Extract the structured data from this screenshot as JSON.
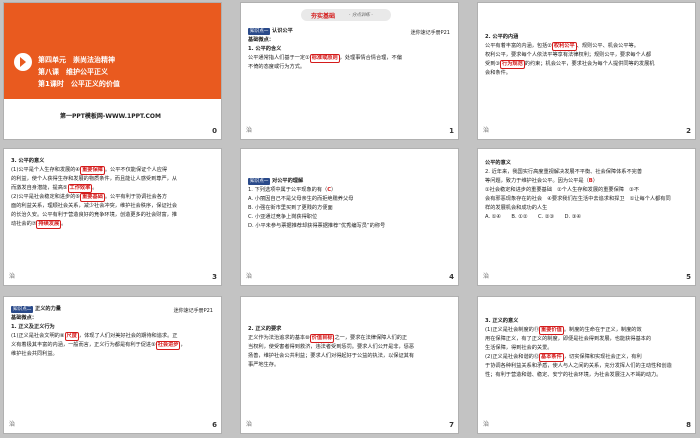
{
  "slides": [
    {
      "page": "0",
      "lines": {
        "unit": "第四单元　崇尚法治精神",
        "lesson": "第八课　维护公平正义",
        "period": "第1课时　公平正义的价值",
        "credit": "第一PPT模板网-WWW.1PPT.COM"
      }
    },
    {
      "page": "1",
      "footer": "治",
      "banner_title": "夯实基础",
      "banner_sub": "· 分点训练 ·",
      "tag": "知识点一",
      "heading": "认识公平",
      "note": "迷你速记手册P21",
      "lines": [
        "基础微点：",
        "1. 公平的含义",
        "公平通常指人们基于一定①",
        "标准或原则",
        "，处理事情合情合理，不偏",
        "不倚的态度或行为方式。"
      ]
    },
    {
      "page": "2",
      "footer": "治",
      "lines": [
        "2. 公平的内涵",
        "公平有着丰富的内涵，包括②",
        "权利公平",
        "、规则公平、机会公平等。",
        "权利公平，要求每个人依法平等享有法律权利；规则公平，要求每个人都",
        "受到③",
        "行为规范",
        "的约束；机会公平，要求社会为每个人提供同等的发展机",
        "会和条件。"
      ]
    },
    {
      "page": "3",
      "footer": "治",
      "lines": [
        "3. 公平的意义",
        "(1)公平是个人生存和发展的④",
        "重要保障",
        "。公平不仅能保证个人应得",
        "的利益，使个人获得生存和发展的物质条件，而且能让人感受到尊严，从",
        "而激发自身潜能，提高⑤",
        "工作效率",
        "。",
        "(2)公平是社会稳定和进步的⑥",
        "重要基础",
        "。公平有利于协调社会各方",
        "面的利益关系，理顺社会关系，减少社会冲突，维护社会秩序，保证社会",
        "的长治久安。公平有利于营造良好的竞争环境，创造更多的社会财富，推",
        "动社会的⑦",
        "持续发展",
        "。"
      ]
    },
    {
      "page": "4",
      "footer": "治",
      "tag": "知识点一",
      "heading": "对公平的理解",
      "lines": [
        "1. 下列选项中属于公平现象的有（",
        "C",
        "）",
        "A. 小丽因自己不是父母亲生的而拒绝赡养父母",
        "B. 小强在街市里买到了更贱的方便面",
        "C. 小亚通过竞争上岗获得职位",
        "D. 小平未参与票据推荐却获得票据推荐“优秀编写员”的称号"
      ]
    },
    {
      "page": "5",
      "footer": "治",
      "lines": [
        "公平的意义",
        "2. 近年来，我国实行高度重视解决发展不平衡、社会保障体系不完善",
        "等问题，致力于维护社会公平。因为公平是（",
        "B",
        "）",
        "①社会稳定和进步的重要基础　②个人生存和发展的重要保障　③不",
        "会有邪恶现象存在的社会　④要求我们在生活中去追求和捍卫　①让每个人都有同",
        "样的发展机会和成功的人生",
        "A. ①④　　B. ①②　　C. ②③　　D. ③④"
      ]
    },
    {
      "page": "6",
      "footer": "治",
      "tag": "知识点二",
      "heading": "正义的力量",
      "note": "迷你速记手册P21",
      "lines": [
        "基础微点：",
        "1. 正义及正义行为",
        "(1)正义是社会文明的⑧",
        "尺度",
        "，体现了人们对美好社会的期待和追求。正",
        "义有着极其丰富的内涵，一般而言，正义行为都是有利于促进⑨",
        "社会进步",
        "，",
        "维护社会共同利益。"
      ]
    },
    {
      "page": "7",
      "footer": "治",
      "lines": [
        "2. 正义的要求",
        "正义作为法治追求的基本⑩",
        "价值目标",
        "之一，要求在法律保障人们的正",
        "当权利，使受害者得到救济，违法者受到惩罚。要求人们公开是非，惩恶",
        "扬善，维护社会公共利益；要求人们对得起好于公益的执法，以保证其有",
        "事严地生存。"
      ]
    },
    {
      "page": "8",
      "footer": "治",
      "lines": [
        "3. 正义的意义",
        "(1)正义是社会制度的⑪",
        "重要价值",
        "。制度的生命在于正义，制度的效",
        "用在保障正义，有了正义的制度，即便是社会得到发展，也能获得基本的",
        "生活保障，得到社会的关爱。",
        "(2)正义是社会和谐的⑫",
        "基本条件",
        "，切实保障和实现社会正义，有利",
        "于协调各种利益关系和矛盾，使人与人之间的关系，充分发挥人们的主动性和创造",
        "性；有利于营造和谐、稳定、安宁的社会环境，为社会发展注入不竭的动力。"
      ]
    }
  ]
}
